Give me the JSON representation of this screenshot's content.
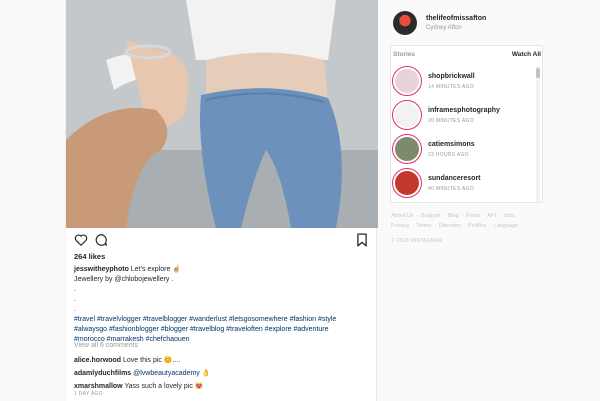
{
  "post": {
    "author": "jesswitheyphoto",
    "caption_text": "Let’s explore ☝🏼",
    "jewellery_line": "Jewellery by @chlobojewellery .",
    "dots": [
      ".",
      ".",
      "."
    ],
    "hashtags_line1": "#travel #travelvlogger #travelblogger #wanderlust #letsgosomewhere #fashion #style",
    "hashtags_line2": "#alwaysgo #fashionblogger #blogger #travelblog #traveloften #explore #adventure",
    "hashtags_line3": "#morocco #marrakesh #chefchaouen",
    "likes": "264 likes",
    "view_all": "View all 6 comments",
    "comments": [
      {
        "user": "alice.horwood",
        "text": "Love this pic 😊....",
        "mention": ""
      },
      {
        "user": "adamlyduchfilms",
        "text": " 👌",
        "mention": "@lvwbeautyacademy"
      },
      {
        "user": "xmarshmallow",
        "text": "Yass such a lovely pic 😻",
        "mention": ""
      }
    ],
    "timestamp": "1 DAY AGO"
  },
  "icons": {
    "like": "heart-icon",
    "comment": "comment-icon",
    "save": "bookmark-icon"
  },
  "profile": {
    "username": "thelifeofmissafton",
    "full_name": "Cydney Afton"
  },
  "stories": {
    "title": "Stories",
    "watch_all": "Watch All",
    "items": [
      {
        "user": "shopbrickwall",
        "time": "14 MINUTES AGO",
        "color": "#e8d4d8"
      },
      {
        "user": "inframesphotography",
        "time": "20 MINUTES AGO",
        "color": "#f2f2f2"
      },
      {
        "user": "catiemsimons",
        "time": "23 HOURS AGO",
        "color": "#7d8a6b"
      },
      {
        "user": "sundanceresort",
        "time": "40 MINUTES AGO",
        "color": "#c0392b"
      }
    ]
  },
  "footer": {
    "links_row1": [
      "About Us",
      "Support",
      "Blog",
      "Press",
      "API",
      "Jobs"
    ],
    "links_row2": [
      "Privacy",
      "Terms",
      "Directory",
      "Profiles",
      "Language"
    ],
    "copyright": "© 2018 INSTAGRAM"
  },
  "colors": {
    "accent_story_ring": "#e1306c",
    "hashtag": "#003569",
    "muted": "#999999"
  }
}
